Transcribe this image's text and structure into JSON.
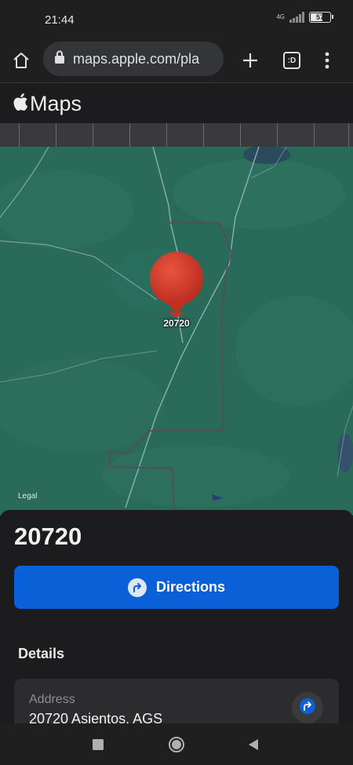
{
  "status_bar": {
    "time": "21:44",
    "network": "4G",
    "battery": "57"
  },
  "browser": {
    "url": "maps.apple.com/pla",
    "tabs_label": ":D",
    "icons": [
      "home-icon",
      "lock-icon",
      "plus-icon",
      "tabs-icon",
      "more-vertical-icon"
    ]
  },
  "header": {
    "brand": "Maps"
  },
  "map": {
    "pin_label": "20720",
    "legal": "Legal",
    "colors": {
      "terrain": "#2a6a59",
      "pin": "#d9382a"
    }
  },
  "place": {
    "title": "20720",
    "directions_label": "Directions",
    "details_heading": "Details",
    "address_label": "Address",
    "address_value": "20720 Asientos, AGS",
    "accent": "#0a60d6"
  },
  "nav": {
    "icons": [
      "recent-apps-icon",
      "home-circle-icon",
      "back-icon"
    ]
  }
}
